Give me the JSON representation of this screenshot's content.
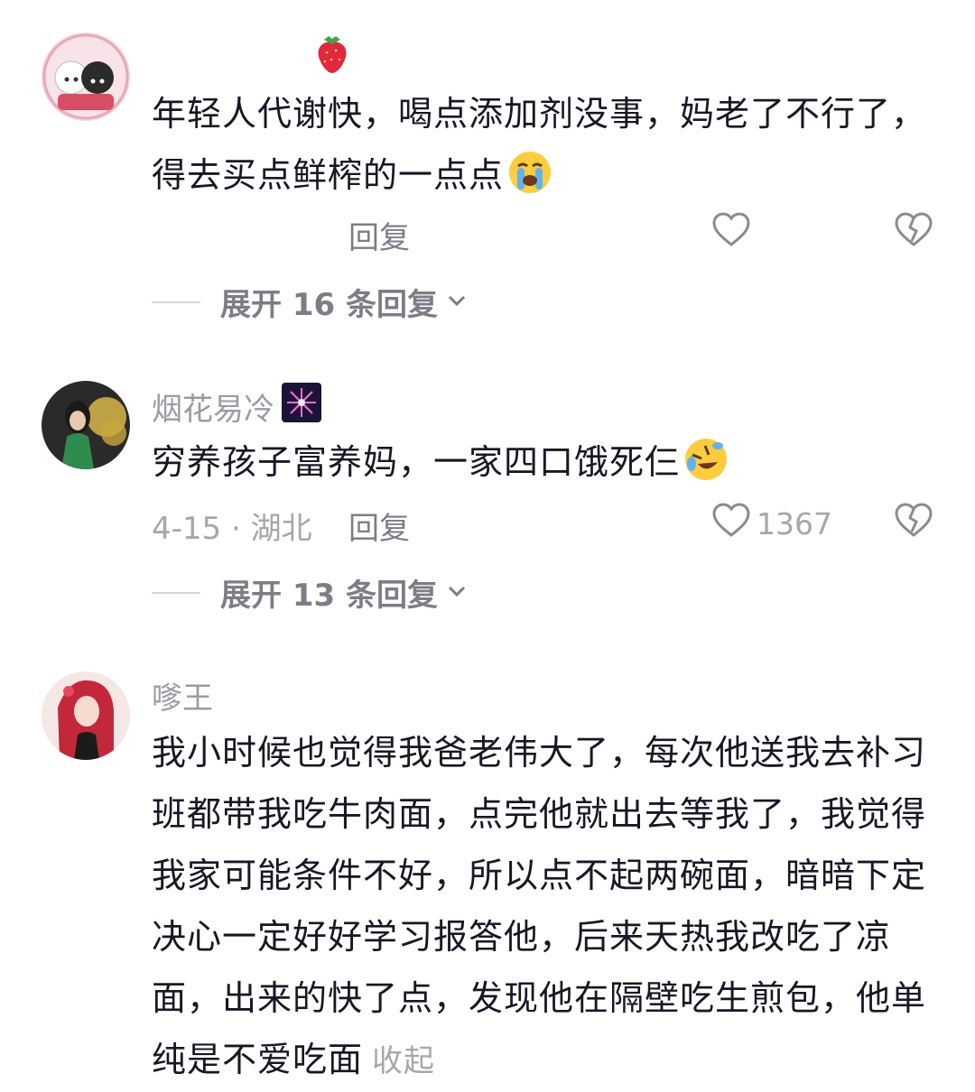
{
  "comments": [
    {
      "username": "",
      "text": "年轻人代谢快，喝点添加剂没事，妈老了不行了，得去买点鲜榨的一点点",
      "emoji": "loudly-crying-face",
      "date": "",
      "reply_label": "回复",
      "like_count": "",
      "expand_label": "展开 16 条回复"
    },
    {
      "username": "烟花易冷",
      "text": "穷养孩子富养妈，一家四口饿死仨",
      "emoji": "rolling-on-floor-laughing-face",
      "date": "4-15 · 湖北",
      "reply_label": "回复",
      "like_count": "1367",
      "expand_label": "展开 13 条回复"
    },
    {
      "username": "嗲王",
      "text": "我小时候也觉得我爸老伟大了，每次他送我去补习班都带我吃牛肉面，点完他就出去等我了，我觉得我家可能条件不好，所以点不起两碗面，暗暗下定决心一定好好学习报答他，后来天热我改吃了凉面，出来的快了点，发现他在隔壁吃生煎包，他单纯是不爱吃面",
      "collapse_label": "收起"
    }
  ],
  "icons": {
    "like": "heart-outline-icon",
    "dislike": "broken-heart-icon",
    "expand": "chevron-down-icon",
    "badge_user1": "strawberry-icon",
    "badge_user2": "firework-icon"
  },
  "colors": {
    "text": "#161823",
    "muted": "#a6a7ad",
    "secondary": "#7c7d85"
  }
}
